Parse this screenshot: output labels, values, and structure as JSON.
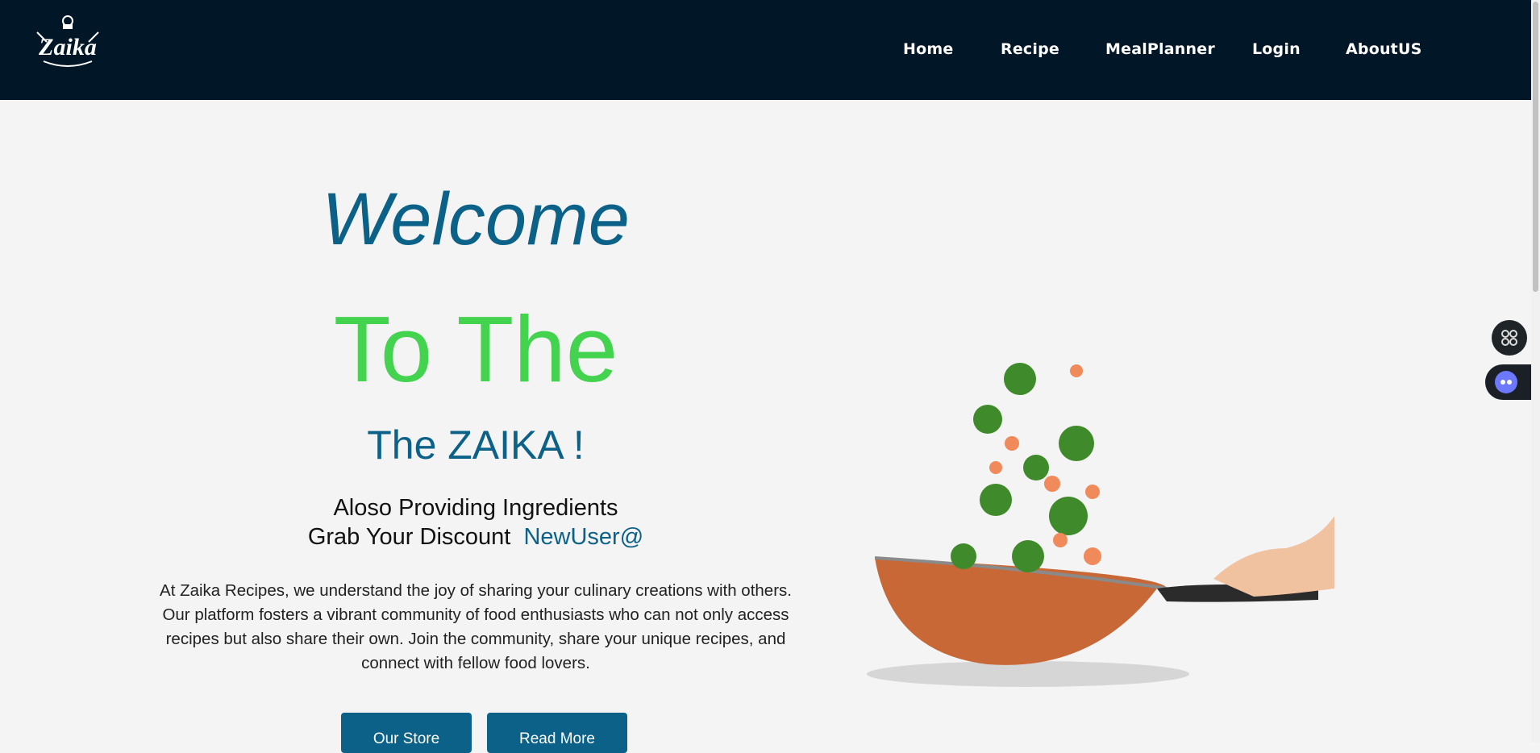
{
  "nav": {
    "logo_text": "Zaika",
    "links": [
      "Home",
      "Recipe",
      "MealPlanner",
      "Login",
      "AboutUS"
    ]
  },
  "hero": {
    "welcome": "Welcome",
    "to_the": "To The",
    "zaika": "The ZAIKA !",
    "line1": "Aloso Providing Ingredients",
    "line2": "Grab Your Discount",
    "coupon": "NewUser@",
    "description": "At Zaika Recipes, we understand the joy of sharing your culinary creations with others. Our platform fosters a vibrant community of food enthusiasts who can not only access recipes but also share their own. Join the community, share your unique recipes, and connect with fellow food lovers.",
    "buttons": [
      "Our Store",
      "Read More"
    ]
  },
  "colors": {
    "navbar": "#011627",
    "accent_blue": "#0c6188",
    "accent_green": "#43d34e"
  }
}
